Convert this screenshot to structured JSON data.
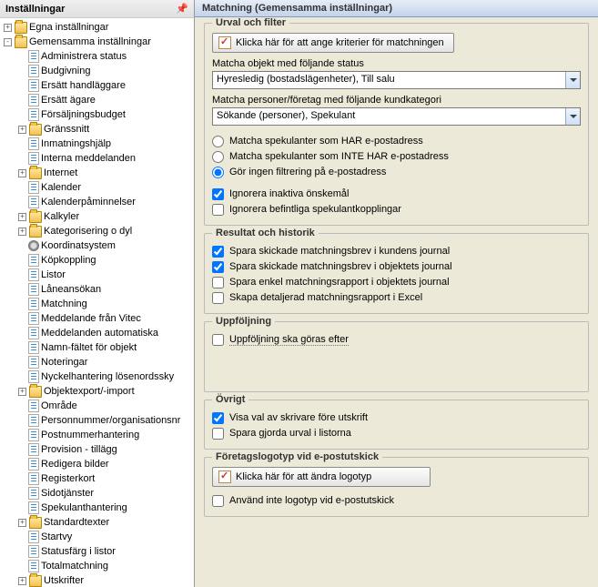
{
  "left": {
    "header": "Inställningar",
    "tree": [
      {
        "level": 0,
        "exp": "+",
        "icon": "folder",
        "label": "Egna inställningar"
      },
      {
        "level": 0,
        "exp": "-",
        "icon": "folder",
        "label": "Gemensamma inställningar"
      },
      {
        "level": 1,
        "exp": "",
        "icon": "page",
        "label": "Administrera status"
      },
      {
        "level": 1,
        "exp": "",
        "icon": "page",
        "label": "Budgivning"
      },
      {
        "level": 1,
        "exp": "",
        "icon": "page",
        "label": "Ersätt handläggare"
      },
      {
        "level": 1,
        "exp": "",
        "icon": "page",
        "label": "Ersätt ägare"
      },
      {
        "level": 1,
        "exp": "",
        "icon": "page",
        "label": "Försäljningsbudget"
      },
      {
        "level": 1,
        "exp": "+",
        "icon": "folder",
        "label": "Gränssnitt"
      },
      {
        "level": 1,
        "exp": "",
        "icon": "page",
        "label": "Inmatningshjälp"
      },
      {
        "level": 1,
        "exp": "",
        "icon": "page",
        "label": "Interna meddelanden"
      },
      {
        "level": 1,
        "exp": "+",
        "icon": "folder",
        "label": "Internet"
      },
      {
        "level": 1,
        "exp": "",
        "icon": "page",
        "label": "Kalender"
      },
      {
        "level": 1,
        "exp": "",
        "icon": "page",
        "label": "Kalenderpåminnelser"
      },
      {
        "level": 1,
        "exp": "+",
        "icon": "folder",
        "label": "Kalkyler"
      },
      {
        "level": 1,
        "exp": "+",
        "icon": "folder",
        "label": "Kategorisering o dyl"
      },
      {
        "level": 1,
        "exp": "",
        "icon": "gear",
        "label": "Koordinatsystem"
      },
      {
        "level": 1,
        "exp": "",
        "icon": "page",
        "label": "Köpkoppling"
      },
      {
        "level": 1,
        "exp": "",
        "icon": "page",
        "label": "Listor"
      },
      {
        "level": 1,
        "exp": "",
        "icon": "page",
        "label": "Låneansökan"
      },
      {
        "level": 1,
        "exp": "",
        "icon": "page",
        "label": "Matchning"
      },
      {
        "level": 1,
        "exp": "",
        "icon": "page",
        "label": "Meddelande från Vitec"
      },
      {
        "level": 1,
        "exp": "",
        "icon": "page",
        "label": "Meddelanden automatiska"
      },
      {
        "level": 1,
        "exp": "",
        "icon": "page",
        "label": "Namn-fältet för objekt"
      },
      {
        "level": 1,
        "exp": "",
        "icon": "page",
        "label": "Noteringar"
      },
      {
        "level": 1,
        "exp": "",
        "icon": "page",
        "label": "Nyckelhantering lösenordssky"
      },
      {
        "level": 1,
        "exp": "+",
        "icon": "folder",
        "label": "Objektexport/-import"
      },
      {
        "level": 1,
        "exp": "",
        "icon": "page",
        "label": "Område"
      },
      {
        "level": 1,
        "exp": "",
        "icon": "page",
        "label": "Personnummer/organisationsnr"
      },
      {
        "level": 1,
        "exp": "",
        "icon": "page",
        "label": "Postnummerhantering"
      },
      {
        "level": 1,
        "exp": "",
        "icon": "page",
        "label": "Provision - tillägg"
      },
      {
        "level": 1,
        "exp": "",
        "icon": "page",
        "label": "Redigera bilder"
      },
      {
        "level": 1,
        "exp": "",
        "icon": "page",
        "label": "Registerkort"
      },
      {
        "level": 1,
        "exp": "",
        "icon": "page",
        "label": "Sidotjänster"
      },
      {
        "level": 1,
        "exp": "",
        "icon": "page",
        "label": "Spekulanthantering"
      },
      {
        "level": 1,
        "exp": "+",
        "icon": "folder",
        "label": "Standardtexter"
      },
      {
        "level": 1,
        "exp": "",
        "icon": "page",
        "label": "Startvy"
      },
      {
        "level": 1,
        "exp": "",
        "icon": "page",
        "label": "Statusfärg i listor"
      },
      {
        "level": 1,
        "exp": "",
        "icon": "page",
        "label": "Totalmatchning"
      },
      {
        "level": 1,
        "exp": "+",
        "icon": "folder",
        "label": "Utskrifter"
      }
    ]
  },
  "right": {
    "header": "Matchning (Gemensamma inställningar)",
    "urval": {
      "title": "Urval och filter",
      "button": "Klicka här för att ange kriterier för matchningen",
      "statusLabel": "Matcha objekt med följande status",
      "statusValue": "Hyresledig (bostadslägenheter), Till salu",
      "kategoriLabel": "Matcha personer/företag med följande kundkategori",
      "kategoriValue": "Sökande (personer), Spekulant",
      "radio1": "Matcha spekulanter som HAR e-postadress",
      "radio2": "Matcha spekulanter som INTE HAR e-postadress",
      "radio3": "Gör ingen filtrering på e-postadress",
      "chk1": "Ignorera inaktiva önskemål",
      "chk2": "Ignorera befintliga spekulantkopplingar"
    },
    "resultat": {
      "title": "Resultat och historik",
      "chk1": "Spara skickade matchningsbrev i kundens journal",
      "chk2": "Spara skickade matchningsbrev i objektets journal",
      "chk3": "Spara enkel matchningsrapport i objektets journal",
      "chk4": "Skapa detaljerad matchningsrapport i Excel"
    },
    "uppfoljning": {
      "title": "Uppföljning",
      "chk1": "Uppföljning ska göras efter"
    },
    "ovrigt": {
      "title": "Övrigt",
      "chk1": "Visa val av skrivare före utskrift",
      "chk2": "Spara gjorda urval i listorna"
    },
    "logotyp": {
      "title": "Företagslogotyp vid e-postutskick",
      "button": "Klicka här för att ändra logotyp",
      "chk1": "Använd inte logotyp vid e-postutskick"
    }
  }
}
